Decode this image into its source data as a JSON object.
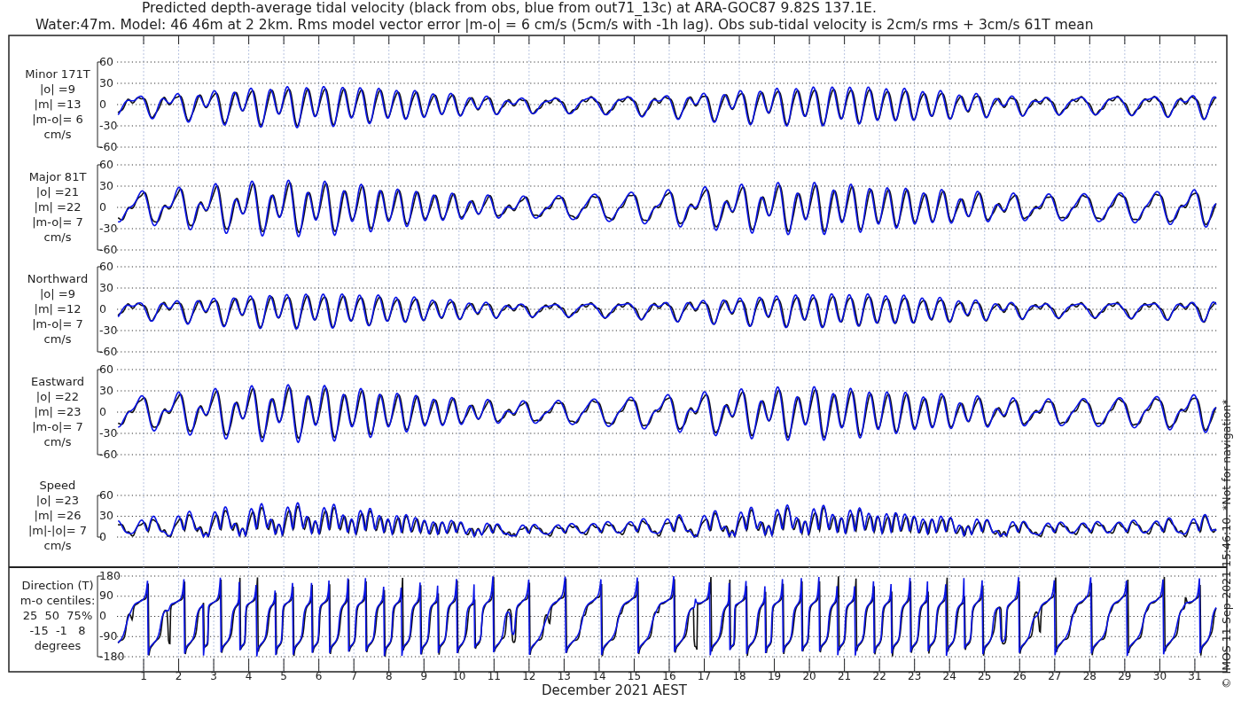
{
  "title_lines": [
    "Predicted depth-average tidal velocity (black from obs, blue from out71_13c) at ARA-GOC87 9.82S 137.1E.",
    "Water:47m. Model: 46 46m at 2 2km. Rms model vector error |m-o| = 6 cm/s (5cm/s with -1h lag). Obs sub-tidal velocity is 2cm/s rms + 3cm/s 61T mean"
  ],
  "panels": [
    {
      "kind": "velocity",
      "label": [
        "Minor 171T",
        "|o| =9",
        "|m| =13",
        "|m-o|= 6",
        "cm/s"
      ],
      "yticks": [
        "60",
        "30",
        "0",
        "-30",
        "-60"
      ]
    },
    {
      "kind": "velocity",
      "label": [
        "Major 81T",
        "|o| =21",
        "|m| =22",
        "|m-o|= 7",
        "cm/s"
      ],
      "yticks": [
        "60",
        "30",
        "0",
        "-30",
        "-60"
      ]
    },
    {
      "kind": "velocity",
      "label": [
        "Northward",
        "|o| =9",
        "|m| =12",
        "|m-o|= 7",
        "cm/s"
      ],
      "yticks": [
        "60",
        "30",
        "0",
        "-30",
        "-60"
      ]
    },
    {
      "kind": "velocity",
      "label": [
        "Eastward",
        "|o| =22",
        "|m| =23",
        "|m-o|= 7",
        "cm/s"
      ],
      "yticks": [
        "60",
        "30",
        "0",
        "-30",
        "-60"
      ]
    },
    {
      "kind": "speed",
      "label": [
        "Speed",
        "|o| =23",
        "|m| =26",
        "|m|-|o|= 7",
        "cm/s"
      ],
      "yticks": [
        "60",
        "30",
        "0"
      ]
    },
    {
      "kind": "direction",
      "label": [
        "Direction (T)",
        "m-o centiles:",
        "25  50  75%",
        "-15  -1   8",
        "degrees"
      ],
      "yticks": [
        "180",
        "90",
        "0",
        "-90",
        "-180"
      ]
    }
  ],
  "xticks": [
    "1",
    "2",
    "3",
    "4",
    "5",
    "6",
    "7",
    "8",
    "9",
    "10",
    "11",
    "12",
    "13",
    "14",
    "15",
    "16",
    "17",
    "18",
    "19",
    "20",
    "21",
    "22",
    "23",
    "24",
    "25",
    "26",
    "27",
    "28",
    "29",
    "30",
    "31"
  ],
  "xlabel": "December 2021 AEST",
  "credit": "© IMOS 11-Sep-2021 15:46:10. *Not for navigation*"
}
